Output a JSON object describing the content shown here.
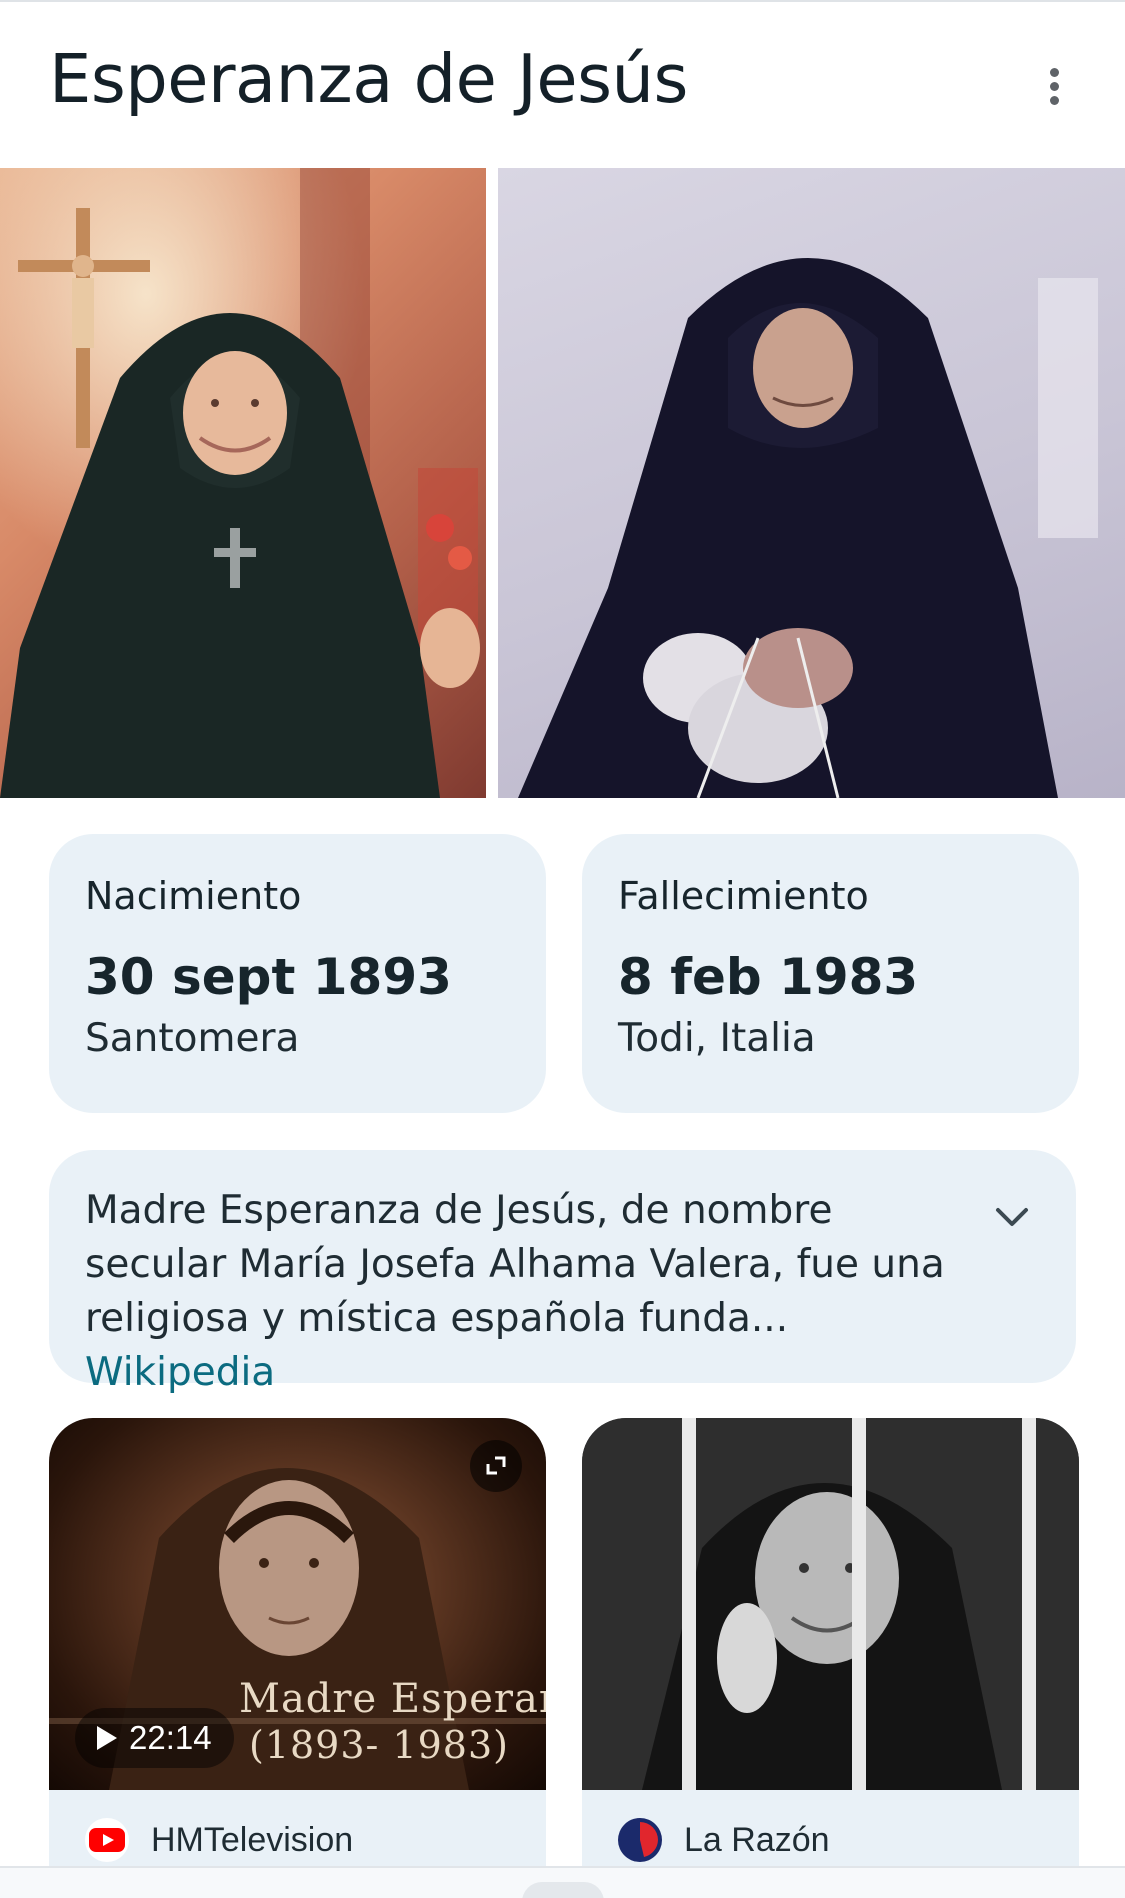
{
  "header": {
    "title": "Esperanza de Jesús",
    "more_icon": "more-vert-icon"
  },
  "images": [
    {
      "name": "portrait-painting",
      "description_icon": "image"
    },
    {
      "name": "knitting-photo",
      "description_icon": "image"
    }
  ],
  "facts": {
    "birth": {
      "label": "Nacimiento",
      "date": "30 sept 1893",
      "place": "Santomera"
    },
    "death": {
      "label": "Fallecimiento",
      "date": "8 feb 1983",
      "place": "Todi, Italia"
    }
  },
  "description": {
    "text": "Madre Esperanza de Jesús, de nombre secular María Josefa Alhama Valera, fue una religiosa y mística española funda",
    "ellipsis": "...",
    "source": "Wikipedia",
    "expand_icon": "chevron-down-icon"
  },
  "results": [
    {
      "type": "video",
      "overlay_title": "Madre Esperanz",
      "overlay_years": "(1893- 1983)",
      "duration": "22:14",
      "source": "HMTelevision",
      "source_icon": "youtube-icon",
      "fullscreen_icon": "fullscreen-icon",
      "play_icon": "play-icon"
    },
    {
      "type": "image",
      "source": "La Razón",
      "source_icon": "la-razon-logo-icon"
    }
  ],
  "colors": {
    "card_background": "#e9f1f7",
    "link": "#0b6b80",
    "title": "#142028"
  }
}
